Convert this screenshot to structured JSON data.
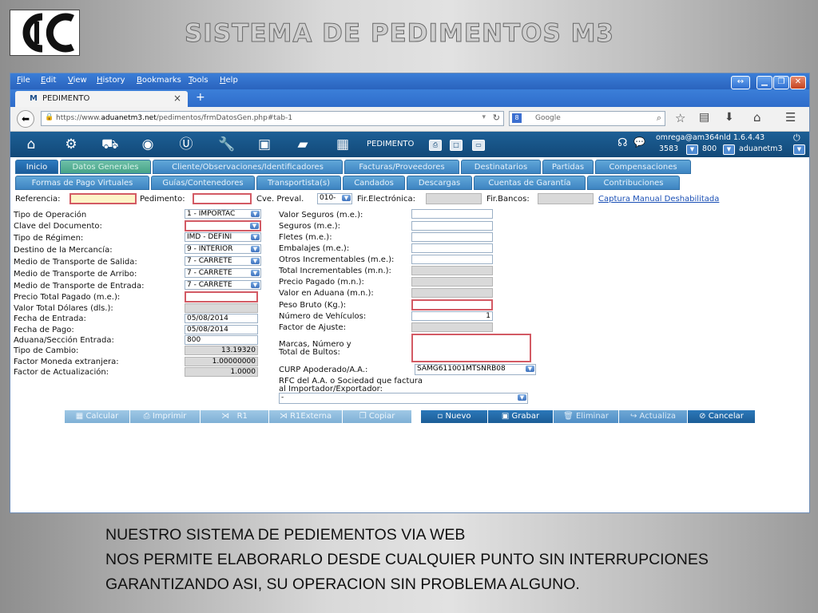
{
  "slide": {
    "title": "SISTEMA DE PEDIMENTOS M3",
    "caption": [
      "NUESTRO SISTEMA DE PEDIEMENTOS VIA WEB",
      "NOS PERMITE ELABORARLO DESDE CUALQUIER PUNTO SIN INTERRUPCIONES",
      "GARANTIZANDO ASI, SU OPERACION SIN PROBLEMA ALGUNO."
    ]
  },
  "browser": {
    "menu": [
      "File",
      "Edit",
      "View",
      "History",
      "Bookmarks",
      "Tools",
      "Help"
    ],
    "tab_title": "PEDIMENTO",
    "tab_close": "×",
    "new_tab": "+",
    "url_prefix": "https://www.",
    "url_host": "aduanetm3.net",
    "url_path": "/pedimentos/frmDatosGen.php#tab-1",
    "search_placeholder": "Google"
  },
  "appbar": {
    "label": "PEDIMENTO",
    "user": "omrega@am364nld  1.6.4.43",
    "select1": "3583",
    "select2": "800",
    "select3": "aduanetm3"
  },
  "tabs_row1": [
    "Inicio",
    "Datos Generales",
    "Cliente/Observaciones/Identificadores",
    "Facturas/Proveedores",
    "Destinatarios",
    "Partidas",
    "Compensaciones"
  ],
  "tabs_row2": [
    "Formas de Pago Virtuales",
    "Guías/Contenedores",
    "Transportista(s)",
    "Candados",
    "Descargas",
    "Cuentas de Garantía",
    "Contribuciones"
  ],
  "header_fields": {
    "referencia": "Referencia:",
    "pedimento": "Pedimento:",
    "cve_preval": "Cve. Preval.",
    "cve_preval_value": "010-",
    "fir_electronica": "Fir.Electrónica:",
    "fir_bancos": "Fir.Bancos:",
    "captura_link": "Captura Manual Deshabilitada"
  },
  "left_fields": [
    {
      "label": "Tipo de Operación",
      "value": "1 - IMPORTAC"
    },
    {
      "label": "Clave del Documento:",
      "value": ""
    },
    {
      "label": "Tipo de Régimen:",
      "value": "IMD - DEFINI"
    },
    {
      "label": "Destino de la Mercancía:",
      "value": "9 - INTERIOR"
    },
    {
      "label": "Medio de Transporte de Salida:",
      "value": "7 - CARRETE"
    },
    {
      "label": "Medio de Transporte de Arribo:",
      "value": "7 - CARRETE"
    },
    {
      "label": "Medio de Transporte de Entrada:",
      "value": "7 - CARRETE"
    },
    {
      "label": "Precio Total Pagado (m.e.):",
      "value": ""
    },
    {
      "label": "Valor Total Dólares (dls.):",
      "value": ""
    },
    {
      "label": "Fecha de Entrada:",
      "value": "05/08/2014"
    },
    {
      "label": "Fecha de Pago:",
      "value": "05/08/2014"
    },
    {
      "label": "Aduana/Sección Entrada:",
      "value": "800"
    },
    {
      "label": "Tipo de Cambio:",
      "value": "13.19320"
    },
    {
      "label": "Factor Moneda extranjera:",
      "value": "1.00000000"
    },
    {
      "label": "Factor de Actualización:",
      "value": "1.0000"
    }
  ],
  "right_fields": [
    {
      "label": "Valor Seguros (m.e.):",
      "value": ""
    },
    {
      "label": "Seguros (m.e.):",
      "value": ""
    },
    {
      "label": "Fletes (m.e.):",
      "value": ""
    },
    {
      "label": "Embalajes (m.e.):",
      "value": ""
    },
    {
      "label": "Otros Incrementables (m.e.):",
      "value": ""
    },
    {
      "label": "Total Incrementables (m.n.):",
      "value": ""
    },
    {
      "label": "Precio Pagado (m.n.):",
      "value": ""
    },
    {
      "label": "Valor en Aduana (m.n.):",
      "value": ""
    },
    {
      "label": "Peso Bruto (Kg.):",
      "value": ""
    },
    {
      "label": "Número de Vehículos:",
      "value": "1"
    },
    {
      "label": "Factor de Ajuste:",
      "value": ""
    }
  ],
  "marcas_label": [
    "Marcas, Número y",
    "Total de Bultos:"
  ],
  "curp_label": "CURP Apoderado/A.A.:",
  "curp_value": "SAMG611001MTSNRB08",
  "rfc_label": [
    "RFC del A.A. o Sociedad que factura",
    "al Importador/Exportador:"
  ],
  "rfc_value": "-",
  "buttons_left": [
    "Calcular",
    "Imprimir",
    "R1",
    "R1Externa",
    "Copiar"
  ],
  "buttons_right": [
    "Nuevo",
    "Grabar",
    "Eliminar",
    "Actualiza",
    "Cancelar"
  ]
}
